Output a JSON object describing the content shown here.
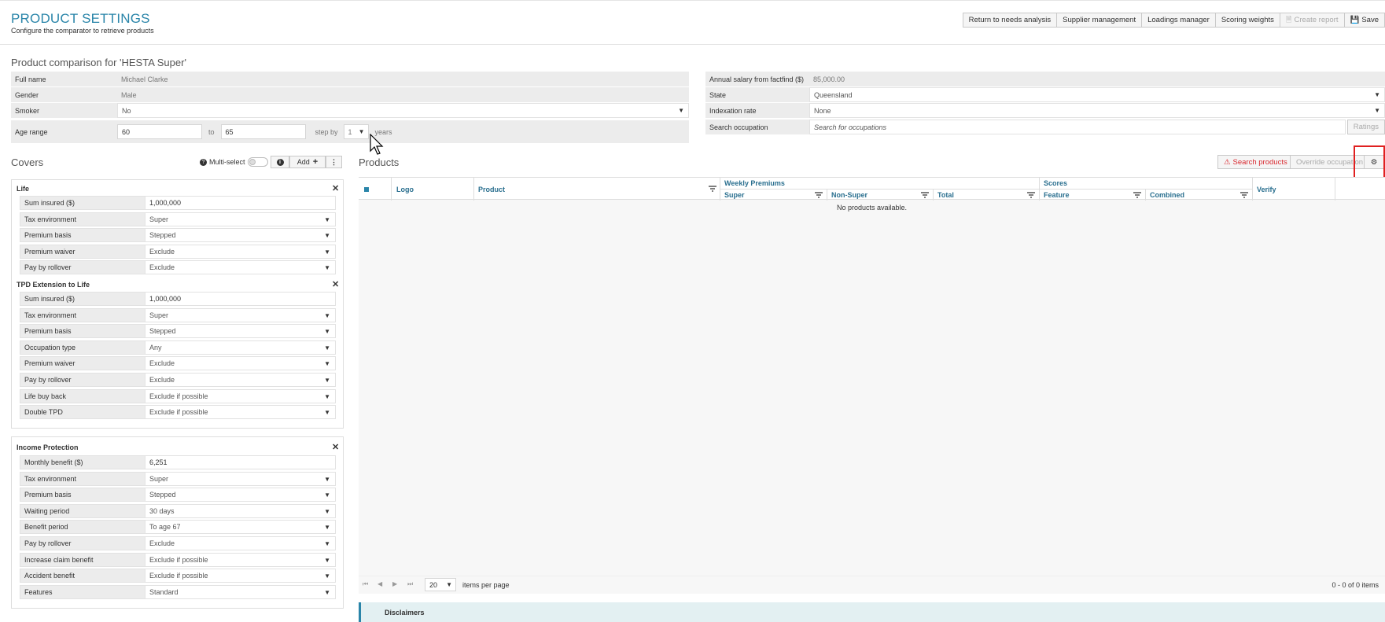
{
  "header": {
    "title": "PRODUCT SETTINGS",
    "subtitle": "Configure the comparator to retrieve products",
    "buttons": {
      "return": "Return to needs analysis",
      "supplier": "Supplier management",
      "loadings": "Loadings manager",
      "scoring": "Scoring weights",
      "create_report": "Create report",
      "save": "Save"
    }
  },
  "comparison": {
    "title": "Product comparison for 'HESTA Super'",
    "full_name_label": "Full name",
    "full_name": "Michael Clarke",
    "gender_label": "Gender",
    "gender": "Male",
    "smoker_label": "Smoker",
    "smoker": "No",
    "age_range_label": "Age range",
    "age_from": "60",
    "to_label": "to",
    "age_to": "65",
    "step_by_label": "step by",
    "step": "1",
    "years_label": "years",
    "salary_label": "Annual salary from factfind ($)",
    "salary": "85,000.00",
    "state_label": "State",
    "state": "Queensland",
    "indexation_label": "Indexation rate",
    "indexation": "None",
    "occupation_label": "Search occupation",
    "occupation_placeholder": "Search for occupations",
    "ratings": "Ratings"
  },
  "covers": {
    "title": "Covers",
    "multiselect": "Multi-select",
    "add": "Add",
    "life": {
      "title": "Life",
      "rows": [
        {
          "label": "Sum insured ($)",
          "value": "1,000,000"
        },
        {
          "label": "Tax environment",
          "value": "Super"
        },
        {
          "label": "Premium basis",
          "value": "Stepped"
        },
        {
          "label": "Premium waiver",
          "value": "Exclude"
        },
        {
          "label": "Pay by rollover",
          "value": "Exclude"
        }
      ]
    },
    "tpd": {
      "title": "TPD Extension to Life",
      "rows": [
        {
          "label": "Sum insured ($)",
          "value": "1,000,000"
        },
        {
          "label": "Tax environment",
          "value": "Super"
        },
        {
          "label": "Premium basis",
          "value": "Stepped"
        },
        {
          "label": "Occupation type",
          "value": "Any"
        },
        {
          "label": "Premium waiver",
          "value": "Exclude"
        },
        {
          "label": "Pay by rollover",
          "value": "Exclude"
        },
        {
          "label": "Life buy back",
          "value": "Exclude if possible"
        },
        {
          "label": "Double TPD",
          "value": "Exclude if possible"
        }
      ]
    },
    "ip": {
      "title": "Income Protection",
      "rows": [
        {
          "label": "Monthly benefit ($)",
          "value": "6,251"
        },
        {
          "label": "Tax environment",
          "value": "Super"
        },
        {
          "label": "Premium basis",
          "value": "Stepped"
        },
        {
          "label": "Waiting period",
          "value": "30 days"
        },
        {
          "label": "Benefit period",
          "value": "To age 67"
        },
        {
          "label": "Pay by rollover",
          "value": "Exclude"
        },
        {
          "label": "Increase claim benefit",
          "value": "Exclude if possible"
        },
        {
          "label": "Accident benefit",
          "value": "Exclude if possible"
        },
        {
          "label": "Features",
          "value": "Standard"
        }
      ]
    }
  },
  "products": {
    "title": "Products",
    "search": "Search products",
    "override": "Override occupation",
    "columns": {
      "logo": "Logo",
      "product": "Product",
      "weekly": "Weekly Premiums",
      "super": "Super",
      "nonsuper": "Non-Super",
      "total": "Total",
      "scores": "Scores",
      "feature": "Feature",
      "combined": "Combined",
      "verify": "Verify"
    },
    "empty": "No products available.",
    "page_size": "20",
    "items_per_page": "items per page",
    "count": "0 - 0 of 0 items",
    "disclaimers": "Disclaimers"
  }
}
